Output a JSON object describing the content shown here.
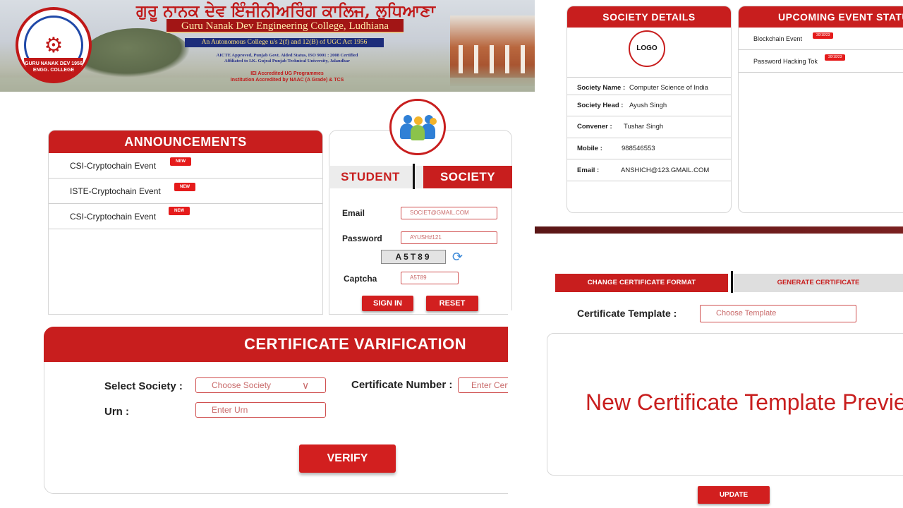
{
  "banner": {
    "punjabi_title": "ਗੁਰੂ ਨਾਨਕ ਦੇਵ ਇੰਜੀਨੀਅਰਿੰਗ ਕਾਲਿਜ, ਲੁਧਿਆਣਾ",
    "college_name": "Guru Nanak Dev Engineering College, Ludhiana",
    "autonomous": "An Autonomous College u/s 2(f) and 12(B) of UGC Act 1956",
    "aicte_line1": "AICTE Approved, Punjab Govt. Aided Status, ISO 9001 : 2008 Certified",
    "aicte_line2": "Affiliated to I.K. Gujral Punjab Technical University, Jalandhar",
    "iei_line1": "IEI Accredited UG Programmes",
    "iei_line2": "Institution Accredited by NAAC (A Grade) & TCS",
    "crest_text": "GURU NANAK DEV 1956 ENGG. COLLEGE"
  },
  "announcements": {
    "title": "ANNOUNCEMENTS",
    "new_badge": "NEW",
    "items": [
      {
        "label": "CSI-Cryptochain Event"
      },
      {
        "label": "ISTE-Cryptochain Event"
      },
      {
        "label": "CSI-Cryptochain Event"
      }
    ]
  },
  "login": {
    "tab_student": "STUDENT",
    "tab_society": "SOCIETY",
    "email_label": "Email",
    "email_value": "SOCIET@GMAIL.COM",
    "password_label": "Password",
    "password_value": "AYUSH#121",
    "captcha_code": "A5T89",
    "captcha_label": "Captcha",
    "captcha_value": "A5T89",
    "signin": "SIGN IN",
    "reset": "RESET"
  },
  "verification": {
    "title": "CERTIFICATE VARIFICATION",
    "society_label": "Select Society :",
    "society_placeholder": "Choose Society",
    "cert_label": "Certificate Number :",
    "cert_placeholder": "Enter Cert",
    "urn_label": "Urn :",
    "urn_placeholder": "Enter Urn",
    "verify": "VERIFY"
  },
  "society_details": {
    "title": "SOCIETY DETAILS",
    "logo": "LOGO",
    "rows": [
      {
        "label": "Society Name :",
        "value": "Computer Science of India"
      },
      {
        "label": "Society Head :",
        "value": "Ayush Singh"
      },
      {
        "label": "Convener :",
        "value": "Tushar Singh"
      },
      {
        "label": "Mobile :",
        "value": "988546553"
      },
      {
        "label": "Email :",
        "value": "ANSHICH@123.GMAIL.COM"
      }
    ]
  },
  "upcoming": {
    "title": "UPCOMING EVENT STATUS",
    "events": [
      {
        "name": "Blockchain Event",
        "date": "30/10/23"
      },
      {
        "name": "Password Hacking Tok",
        "date": "30/10/23"
      }
    ]
  },
  "certificate": {
    "tab_change": "CHANGE CERTIFICATE FORMAT",
    "tab_generate": "GENERATE CERTIFICATE",
    "template_label": "Certificate Template :",
    "template_placeholder": "Choose Template",
    "preview_text": "New Certificate Template Preview",
    "update": "UPDATE"
  },
  "colors": {
    "accent": "#c81e1e",
    "divider": "#5a1616",
    "navy": "#1d2d7b"
  },
  "icons": [
    "crest-logo",
    "group-users-icon",
    "refresh-icon",
    "chevron-down-icon"
  ]
}
